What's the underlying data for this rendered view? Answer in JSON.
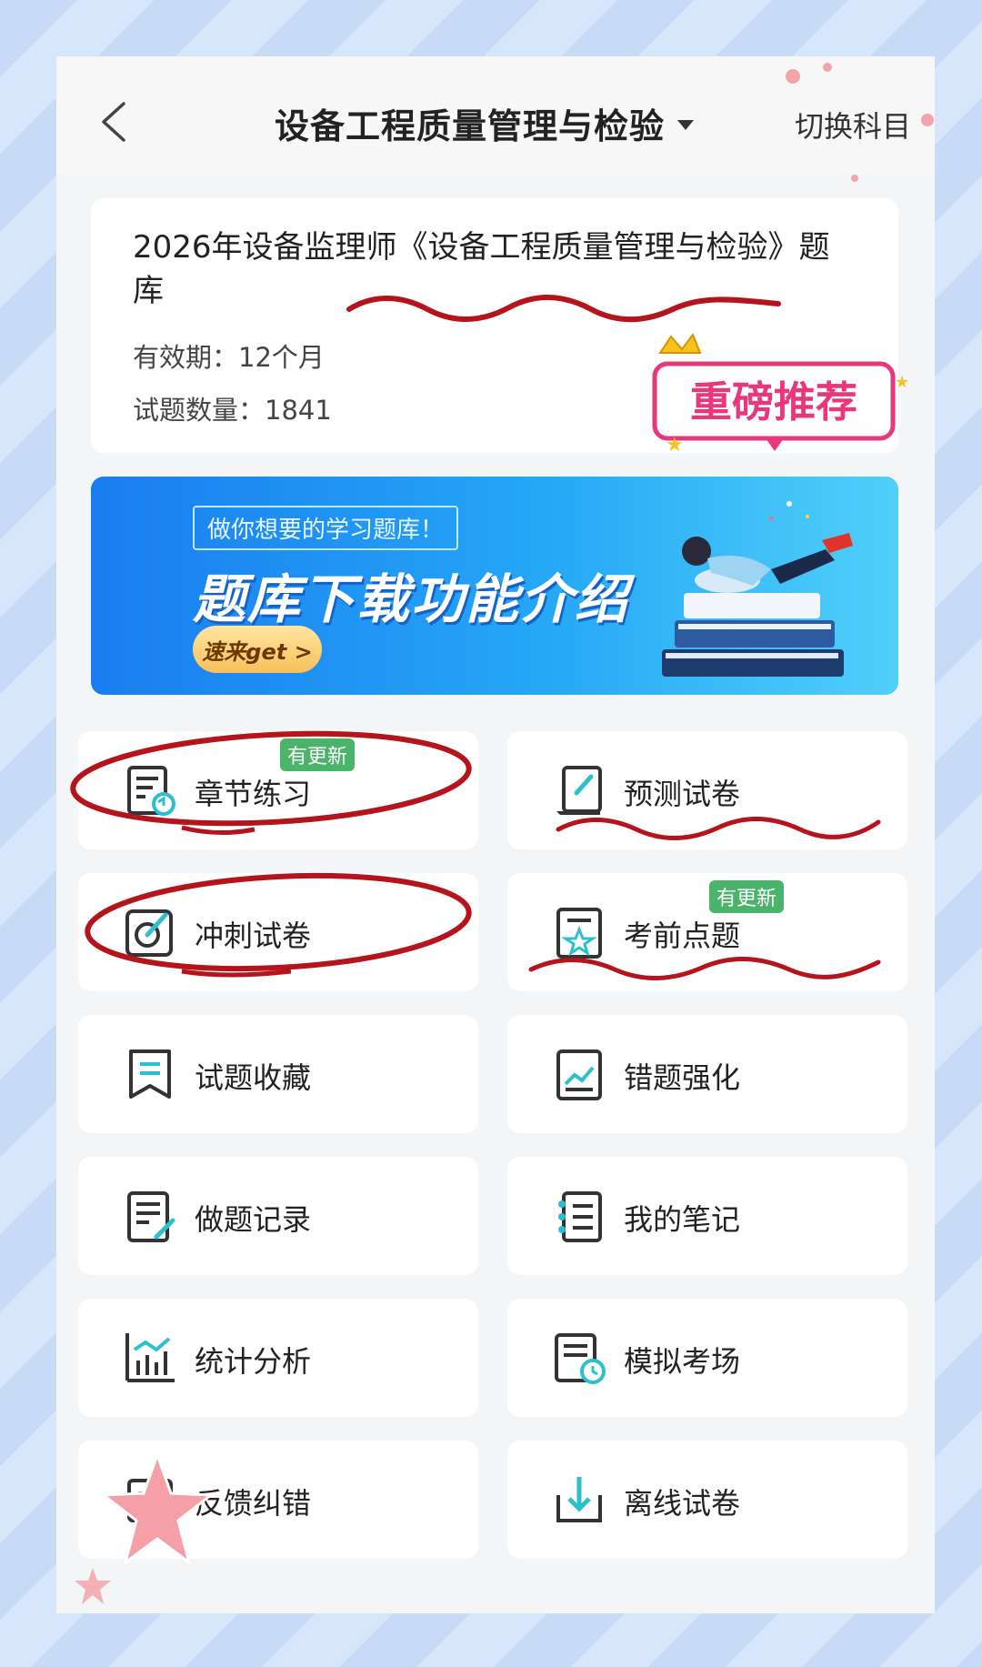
{
  "header": {
    "title": "设备工程质量管理与检验",
    "switch_label": "切换科目"
  },
  "info": {
    "title": "2026年设备监理师《设备工程质量管理与检验》题库",
    "validity": "有效期：12个月",
    "count": "试题数量：1841",
    "recommend_label": "重磅推荐"
  },
  "banner": {
    "subtitle": "做你想要的学习题库！",
    "title": "题库下载功能介绍",
    "button": "速来get >"
  },
  "tiles": [
    {
      "label": "章节练习",
      "icon": "chapter-practice-icon",
      "badge": "有更新"
    },
    {
      "label": "预测试卷",
      "icon": "forecast-paper-icon",
      "badge": ""
    },
    {
      "label": "冲刺试卷",
      "icon": "sprint-paper-icon",
      "badge": ""
    },
    {
      "label": "考前点题",
      "icon": "pre-exam-icon",
      "badge": "有更新"
    },
    {
      "label": "试题收藏",
      "icon": "bookmark-icon",
      "badge": ""
    },
    {
      "label": "错题强化",
      "icon": "wrong-questions-icon",
      "badge": ""
    },
    {
      "label": "做题记录",
      "icon": "record-icon",
      "badge": ""
    },
    {
      "label": "我的笔记",
      "icon": "notes-icon",
      "badge": ""
    },
    {
      "label": "统计分析",
      "icon": "statistics-icon",
      "badge": ""
    },
    {
      "label": "模拟考场",
      "icon": "mock-exam-icon",
      "badge": ""
    },
    {
      "label": "反馈纠错",
      "icon": "feedback-icon",
      "badge": ""
    },
    {
      "label": "离线试卷",
      "icon": "download-icon",
      "badge": ""
    }
  ],
  "colors": {
    "accent": "#2bbfcf",
    "badge": "#4cb36b",
    "annotation": "#b5141c",
    "recommend": "#e8377a"
  }
}
